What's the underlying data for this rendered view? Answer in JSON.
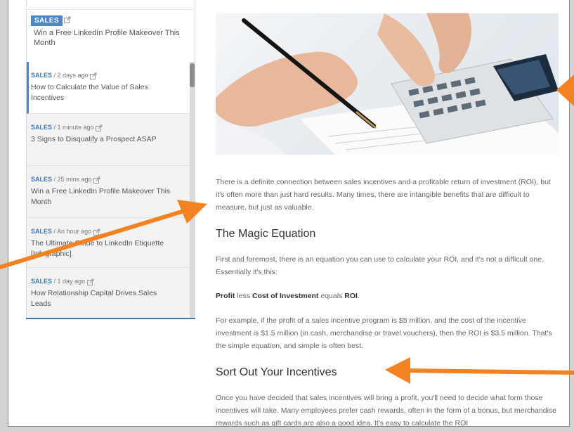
{
  "colors": {
    "accent": "#4d88c4",
    "arrow": "#f58220"
  },
  "sidebar": {
    "featured": {
      "category": "SALES",
      "title": "Win a Free LinkedIn Profile Makeover This Month"
    },
    "items": [
      {
        "category": "SALES",
        "time": "/ 2 days ago",
        "title": "How to Calculate the Value of Sales Incentives"
      },
      {
        "category": "SALES",
        "time": "/ 1 minute ago",
        "title": "3 Signs to Disqualify a Prospect ASAP"
      },
      {
        "category": "SALES",
        "time": "/ 25 mins ago",
        "title": "Win a Free LinkedIn Profile Makeover This Month"
      },
      {
        "category": "SALES",
        "time": "/ An hour ago",
        "title": "The Ultimate Guide to LinkedIn Etiquette [Infographic]"
      },
      {
        "category": "SALES",
        "time": "/ 1 day ago",
        "title": "How Relationship Capital Drives Sales Leads"
      }
    ]
  },
  "article": {
    "image_alt": "hands using calculator and pen",
    "intro": "There is a definite connection between sales incentives and a profitable return of investment (ROI), but it's often more than just hard results. Many times, there are intangible benefits that are difficult to measure, but just as valuable.",
    "heading1": "The Magic Equation",
    "para1": "First and foremost, there is an equation you can use to calculate your ROI, and it's not a difficult one. Essentially it's this:",
    "equation": {
      "profit": "Profit",
      "less": " less ",
      "cost": "Cost of Investment",
      "equals": " equals ",
      "roi": "ROI",
      "end": "."
    },
    "para2": "For example, if the profit of a sales incentive program is $5 million, and the cost of the incentive investment is $1.5 million (in cash, merchandise or travel vouchers), then the ROI is $3.5 million. That's the simple equation, and simple is often best.",
    "heading2": "Sort Out Your Incentives",
    "para3": "Once you have decided that sales incentives will bring a profit, you'll need to decide what form those incentives will take. Many employees prefer cash rewards, often in the form of a bonus, but merchandise rewards such as gift cards are also a good idea. It's easy to calculate the ROI"
  }
}
